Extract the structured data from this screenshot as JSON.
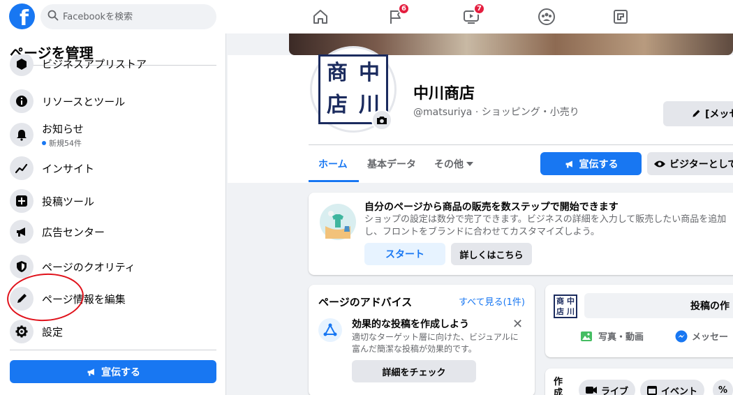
{
  "topbar": {
    "logo_letter": "f",
    "search_placeholder": "Facebookを検索",
    "nav": [
      {
        "name": "home",
        "badge": ""
      },
      {
        "name": "pages-flag",
        "badge": "6"
      },
      {
        "name": "watch",
        "badge": "7"
      },
      {
        "name": "groups",
        "badge": ""
      },
      {
        "name": "gaming",
        "badge": ""
      }
    ]
  },
  "sidebar": {
    "title": "ページを管理",
    "items": [
      {
        "label": "ビジネスアプリストア",
        "icon": "box-icon"
      },
      {
        "label": "リソースとツール",
        "icon": "info-icon"
      },
      {
        "label": "お知らせ",
        "sub": "新規54件",
        "icon": "bell-icon"
      },
      {
        "label": "インサイト",
        "icon": "chart-icon"
      },
      {
        "label": "投稿ツール",
        "icon": "post-tools-icon"
      },
      {
        "label": "広告センター",
        "icon": "megaphone-icon"
      },
      {
        "label": "ページのクオリティ",
        "icon": "shield-icon"
      },
      {
        "label": "ページ情報を編集",
        "icon": "pencil-icon"
      },
      {
        "label": "設定",
        "icon": "gear-icon"
      }
    ],
    "promote_label": "宣伝する"
  },
  "profile": {
    "kanji": [
      "中",
      "商",
      "川",
      "店"
    ],
    "name": "中川商店",
    "handle": "@matsuriya · ショッピング・小売り",
    "message_label": "[メッセ"
  },
  "tabs": {
    "home": "ホーム",
    "about": "基本データ",
    "more": "その他"
  },
  "actions": {
    "promote": "宣伝する",
    "visitor": "ビジターとして"
  },
  "shop_card": {
    "title": "自分のページから商品の販売を数ステップで開始できます",
    "desc": "ショップの設定は数分で完了できます。ビジネスの詳細を入力して販売したい商品を追加し、フロントをブランドに合わせてカスタマイズしよう。",
    "start": "スタート",
    "learn": "詳しくはこちら"
  },
  "advice_card": {
    "title": "ページのアドバイス",
    "see_all": "すべて見る(1件)",
    "heading": "効果的な投稿を作成しよう",
    "desc": "適切なターゲット層に向けた、ビジュアルに富んだ簡潔な投稿が効果的です。",
    "check": "詳細をチェック"
  },
  "post_card": {
    "create_post": "投稿の作",
    "photo": "写真・動画",
    "message": "メッセー"
  },
  "create_card": {
    "label": "作成",
    "live": "ライブ",
    "event": "イベント"
  },
  "colors": {
    "brand": "#1877f2",
    "badge": "#e41e3f",
    "annotation": "#e0121b"
  }
}
